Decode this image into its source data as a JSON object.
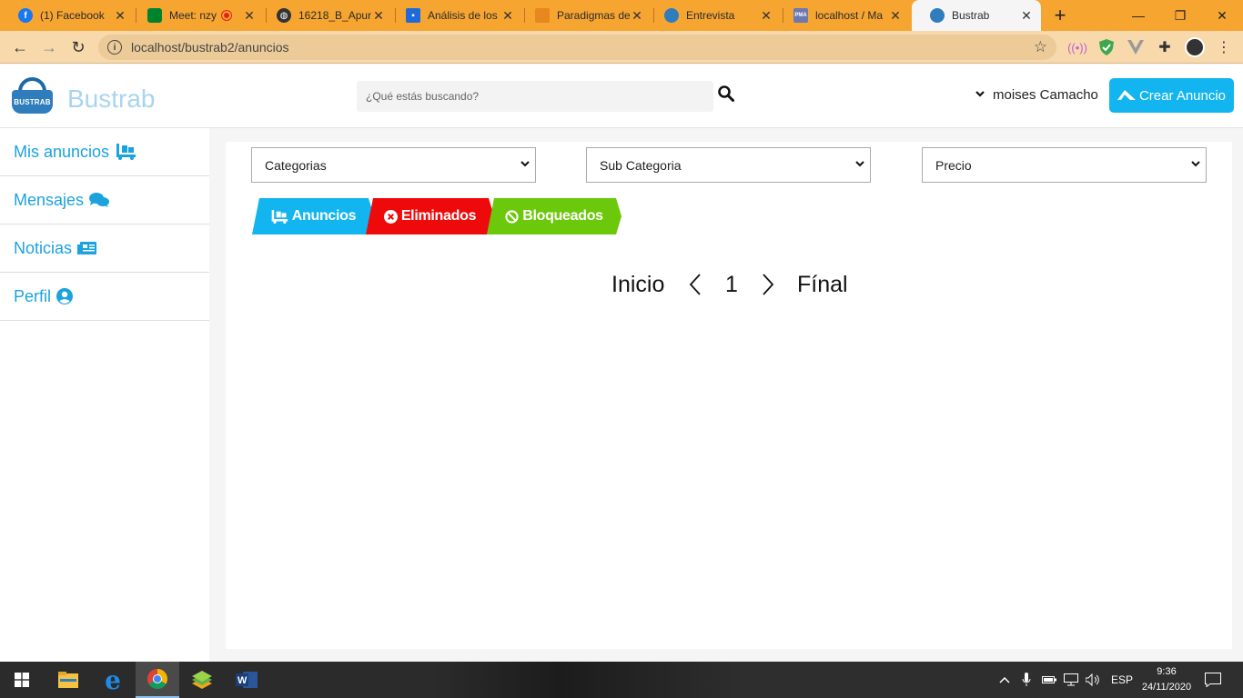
{
  "browser": {
    "tabs": [
      {
        "title": "(1) Facebook",
        "icon": "facebook-icon",
        "color": "#1877f2"
      },
      {
        "title": "Meet: nzy",
        "icon": "meet-icon",
        "color": "#00832d"
      },
      {
        "title": "16218_B_Apun",
        "icon": "globe-icon",
        "color": "#333333"
      },
      {
        "title": "Análisis de los",
        "icon": "classroom-icon",
        "color": "#1e6ad9"
      },
      {
        "title": "Paradigmas de",
        "icon": "slides-icon",
        "color": "#e8871e"
      },
      {
        "title": "Entrevista",
        "icon": "bustrab-icon",
        "color": "#2f7dbd"
      },
      {
        "title": "localhost / Ma",
        "icon": "phpmyadmin-icon",
        "color": "#6c78af"
      },
      {
        "title": "Bustrab",
        "icon": "bustrab-icon",
        "color": "#2f7dbd"
      }
    ],
    "url": "localhost/bustrab2/anuncios"
  },
  "header": {
    "logo_text": "BUSTRAB",
    "brand": "Bustrab",
    "search_placeholder": "¿Qué estás buscando?",
    "user_name": "moises Camacho",
    "create_label": "Crear Anuncio"
  },
  "sidebar": {
    "items": [
      {
        "label": "Mis anuncios",
        "icon": "dolly-icon"
      },
      {
        "label": "Mensajes",
        "icon": "comments-icon"
      },
      {
        "label": "Noticias",
        "icon": "newspaper-icon"
      },
      {
        "label": "Perfil",
        "icon": "user-circle-icon"
      }
    ]
  },
  "filters": {
    "categoria": "Categorias",
    "subcategoria": "Sub Categoria",
    "precio": "Precio"
  },
  "status_tabs": [
    {
      "label": "Anuncios",
      "icon": "dolly-icon",
      "color": "#12b5ef"
    },
    {
      "label": "Eliminados",
      "icon": "times-circle-icon",
      "color": "#ee0a0a"
    },
    {
      "label": "Bloqueados",
      "icon": "ban-icon",
      "color": "#6cc80a"
    }
  ],
  "pagination": {
    "first": "Inicio",
    "current": "1",
    "last": "Fínal"
  },
  "taskbar": {
    "language": "ESP",
    "time": "9:36",
    "date": "24/11/2020"
  }
}
